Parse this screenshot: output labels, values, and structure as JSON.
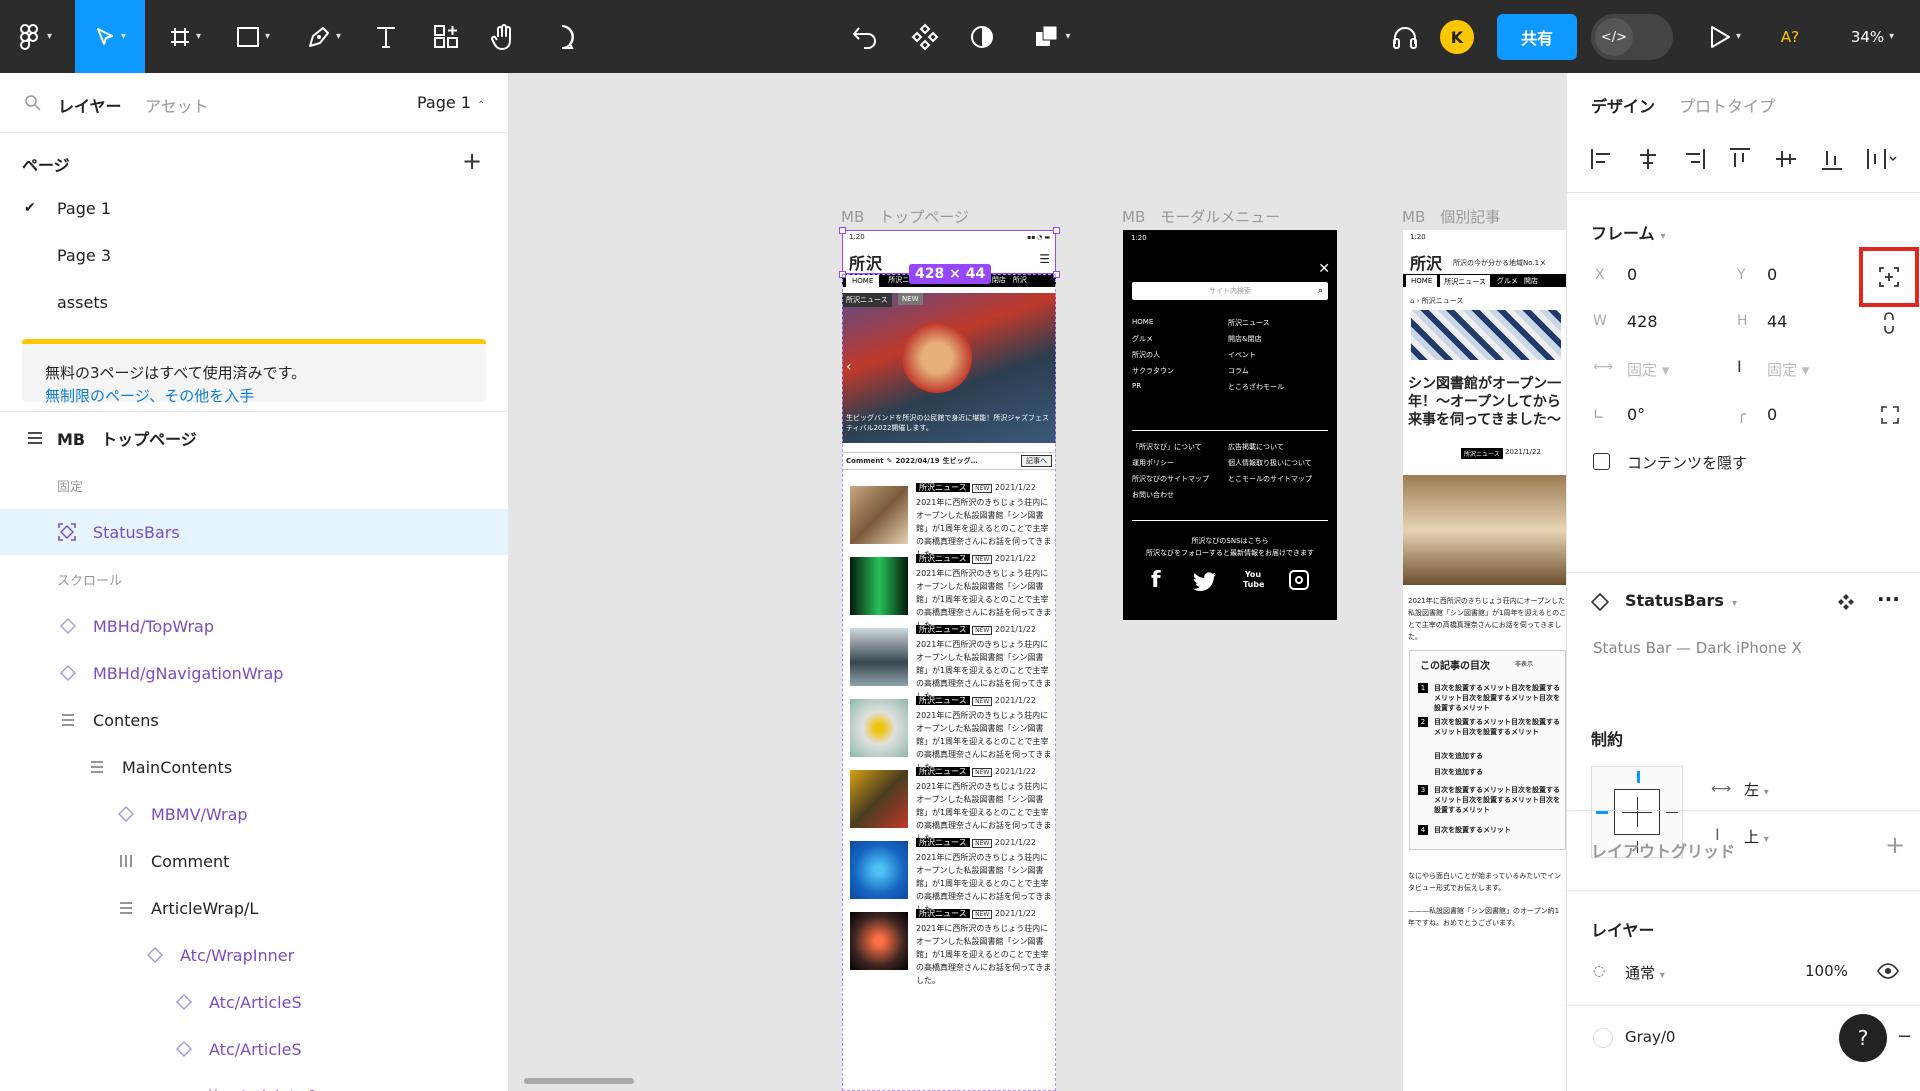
{
  "toolbar": {
    "tools": [
      {
        "name": "main-menu"
      },
      {
        "name": "move-tool",
        "active": true
      },
      {
        "name": "frame-tool"
      },
      {
        "name": "shape-tool"
      },
      {
        "name": "pen-tool"
      },
      {
        "name": "text-tool"
      },
      {
        "name": "resources-tool"
      },
      {
        "name": "hand-tool"
      },
      {
        "name": "comment-tool"
      }
    ],
    "avatar_initial": "K",
    "share_label": "共有",
    "font_warning": "A?",
    "zoom": "34%"
  },
  "left_panel": {
    "tab_layers": "レイヤー",
    "tab_assets": "アセット",
    "page_selector": "Page 1",
    "pages_header": "ページ",
    "pages": [
      "Page 1",
      "Page 3",
      "assets"
    ],
    "notice_text": "無料の3ページはすべて使用済みです。",
    "notice_link": "無制限のページ、その他を入手",
    "layers": [
      {
        "label": "MB　トップページ",
        "indent": 0,
        "kind": "frame",
        "bold": true
      },
      {
        "label": "固定",
        "indent": 0,
        "kind": "section"
      },
      {
        "label": "StatusBars",
        "indent": 0,
        "kind": "instance",
        "selected": true
      },
      {
        "label": "スクロール",
        "indent": 0,
        "kind": "section"
      },
      {
        "label": "MBHd/TopWrap",
        "indent": 0,
        "kind": "instance"
      },
      {
        "label": "MBHd/gNavigationWrap",
        "indent": 0,
        "kind": "instance"
      },
      {
        "label": "Contens",
        "indent": 0,
        "kind": "autolayout"
      },
      {
        "label": "MainContents",
        "indent": 1,
        "kind": "autolayout"
      },
      {
        "label": "MBMV/Wrap",
        "indent": 2,
        "kind": "instance"
      },
      {
        "label": "Comment",
        "indent": 2,
        "kind": "hlayout"
      },
      {
        "label": "ArticleWrap/L",
        "indent": 2,
        "kind": "autolayout"
      },
      {
        "label": "Atc/WrapInner",
        "indent": 3,
        "kind": "instance"
      },
      {
        "label": "Atc/ArticleS",
        "indent": 4,
        "kind": "instance"
      },
      {
        "label": "Atc/ArticleS",
        "indent": 4,
        "kind": "instance"
      },
      {
        "label": "ArticleLeft",
        "indent": 5,
        "kind": "frame-hash"
      }
    ]
  },
  "canvas": {
    "frames": [
      {
        "title": "MB　トップページ"
      },
      {
        "title": "MB　モーダルメニュー"
      },
      {
        "title": "MB　個別記事"
      }
    ],
    "size_badge": "428 × 44",
    "top_page": {
      "status_time": "1:20",
      "logo": "所沢",
      "nav": [
        "HOME",
        "所沢ニュース",
        "グルメ",
        "開店＆閉店",
        "所沢"
      ],
      "hero_tag": "所沢ニュース",
      "hero_new": "NEW",
      "hero_caption": "生ビッグバンドを所沢の公民館で身近に堪能！所沢ジャズフェスティバル2022開催します。",
      "comment_label": "Comment",
      "comment_date": "2022/04/19",
      "comment_text": "生ビッグ…",
      "comment_btn": "記事へ",
      "article_tag": "所沢ニュース",
      "article_new": "NEW",
      "article_date": "2021/1/22",
      "article_body": "2021年に西所沢のきちじょう荘内にオープンした私設図書館「シン図書館」が1周年を迎えるとのことで主宰の高橋真理奈さんにお話を伺ってきました。"
    },
    "modal": {
      "status_time": "1:20",
      "search_placeholder": "サイト内検索",
      "menu_left": [
        "HOME",
        "グルメ",
        "所沢の人",
        "サクラタウン",
        "PR"
      ],
      "menu_right": [
        "所沢ニュース",
        "開店&閉店",
        "イベント",
        "コラム",
        "ところざわモール"
      ],
      "links_left": [
        "「所沢なび」について",
        "運用ポリシー",
        "所沢なびのサイトマップ",
        "お問い合わせ"
      ],
      "links_right": [
        "広告掲載について",
        "個人情報取り扱いについて",
        "とこモールのサイトマップ"
      ],
      "sns_line1": "所沢なびのSNSはこちら",
      "sns_line2": "所沢なびをフォローすると最新情報をお届けできます",
      "youtube_label": "You Tube"
    },
    "article_page": {
      "status_time": "1:20",
      "logo": "所沢",
      "tagline": "所沢の今が分かる地域No.1メ",
      "nav": [
        "HOME",
        "所沢ニュース",
        "グルメ",
        "開店"
      ],
      "breadcrumb": "所沢ニュース",
      "headline": "シン図書館がオープン一年！〜オープンしてから来事を伺ってきました〜",
      "tag": "所沢ニュース",
      "date": "2021/1/22",
      "body": "2021年に西所沢のきちじょう荘内にオープンした私設図書館「シン図書館」が1周年を迎えるとのことで主宰の高橋真理奈さんにお話を伺ってきました。",
      "toc_title": "この記事の目次",
      "toc_toggle": "非表示",
      "toc_items": [
        {
          "num": "1",
          "text": "目次を設置するメリット目次を設置するメリット目次を設置するメリット目次を設置するメリット"
        },
        {
          "num": "2",
          "text": "目次を設置するメリット目次を設置するメリット目次を設置するメリット"
        },
        {
          "num": "",
          "text": "目次を追加する"
        },
        {
          "num": "",
          "text": "目次を追加する"
        },
        {
          "num": "3",
          "text": "目次を設置するメリット目次を設置するメリット目次を設置するメリット目次を設置するメリット"
        },
        {
          "num": "4",
          "text": "目次を設置するメリット"
        }
      ],
      "footer_text1": "なにやら面白いことが始まっているみたいでインタビュー形式でお伝えします。",
      "footer_text2": "———私設図書館「シン図書館」のオープン約1年ですね。おめでとうございます。"
    }
  },
  "right_panel": {
    "tab_design": "デザイン",
    "tab_prototype": "プロトタイプ",
    "frame_header": "フレーム",
    "x_label": "X",
    "x_value": "0",
    "y_label": "Y",
    "y_value": "0",
    "w_label": "W",
    "w_value": "428",
    "h_label": "H",
    "h_value": "44",
    "fixed_h": "固定",
    "fixed_v": "固定",
    "rotation": "0°",
    "radius": "0",
    "clip_content": "コンテンツを隠す",
    "component_name": "StatusBars",
    "component_desc": "Status Bar — Dark iPhone X",
    "constraints_header": "制約",
    "constraint_h": "左",
    "constraint_v": "上",
    "layout_grid_header": "レイアウトグリッド",
    "layer_header": "レイヤー",
    "blend_mode": "通常",
    "opacity": "100%",
    "fill_name": "Gray/0",
    "help": "?"
  },
  "colors": {
    "toolbar_bg": "#2c2c2c",
    "accent": "#0d99ff",
    "component_purple": "#7b4cc4",
    "selection_purple": "#9747ff",
    "highlight_red": "#e5261f"
  }
}
